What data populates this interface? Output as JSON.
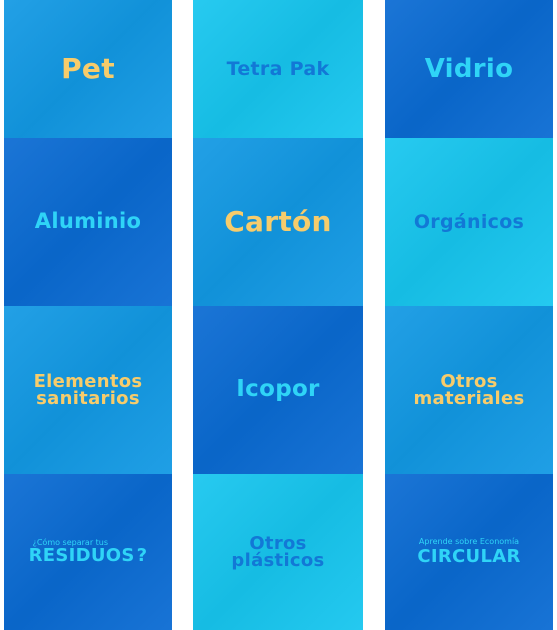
{
  "colors": {
    "dark_blue": "#0a6bd3",
    "mid_blue": "#1299e4",
    "light_cyan": "#17c6ef",
    "yellow": "#f7cc6b",
    "cyan_text": "#2fd4f7",
    "blue_text": "#1278d6",
    "gutter": "#ffffff"
  },
  "tiles": [
    {
      "label": "Pet"
    },
    {
      "label": "Aluminio"
    },
    {
      "label": "Elementos sanitarios"
    },
    {
      "label_small": "¿Cómo separar tus",
      "label": "RESIDUOS",
      "suffix": "?"
    },
    {
      "label": "Tetra Pak"
    },
    {
      "label": "Cartón"
    },
    {
      "label": "Icopor"
    },
    {
      "label": "Otros plásticos"
    },
    {
      "label": "Vidrio"
    },
    {
      "label": "Orgánicos"
    },
    {
      "label": "Otros materiales"
    },
    {
      "label_small": "Aprende sobre Economía",
      "label": "CIRCULAR"
    }
  ]
}
